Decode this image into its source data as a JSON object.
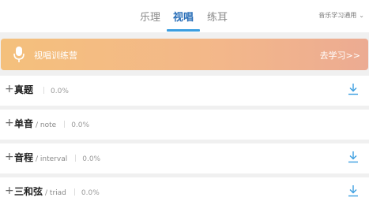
{
  "tabs": [
    {
      "label": "乐理"
    },
    {
      "label": "视唱"
    },
    {
      "label": "练耳"
    }
  ],
  "active_tab": "视唱",
  "app_select": {
    "label": "音乐学习通用",
    "icon": "chevron-down-icon"
  },
  "banner": {
    "icon": "microphone-icon",
    "title": "视唱训练营",
    "link": "去学习>>"
  },
  "rows": [
    {
      "title": "真题",
      "subtitle": "",
      "progress": "0.0%"
    },
    {
      "title": "单音",
      "subtitle": "/ note",
      "progress": "0.0%"
    },
    {
      "title": "音程",
      "subtitle": "/ interval",
      "progress": "0.0%"
    },
    {
      "title": "三和弦",
      "subtitle": "/ triad",
      "progress": "0.0%"
    }
  ],
  "icons": {
    "expand": "plus-icon",
    "download": "download-icon"
  },
  "colors": {
    "accent": "#3b9ee0",
    "active_tab_text": "#2a6fb8",
    "banner_start": "#f4c07c",
    "banner_end": "#ecab92"
  }
}
